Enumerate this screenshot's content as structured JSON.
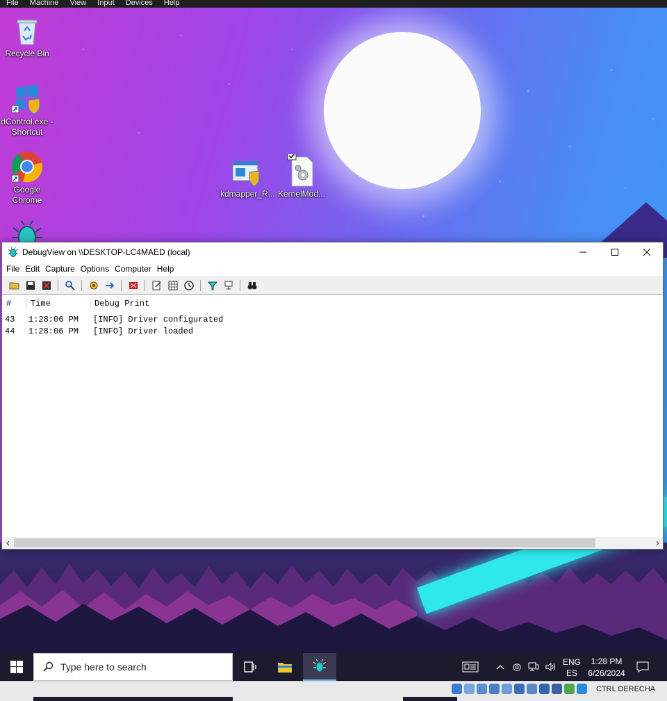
{
  "vm": {
    "menu": [
      "File",
      "Machine",
      "View",
      "Input",
      "Devices",
      "Help"
    ],
    "host_key": "CTRL DERECHA"
  },
  "desktop": {
    "icons": [
      {
        "label": "Recycle Bin"
      },
      {
        "label": "dControl.exe - Shortcut"
      },
      {
        "label": "Google Chrome"
      },
      {
        "label": "kdmapper_R..."
      },
      {
        "label": "KernelMod..."
      }
    ]
  },
  "debugview": {
    "title": "DebugView on \\\\DESKTOP-LC4MAED (local)",
    "menu": [
      "File",
      "Edit",
      "Capture",
      "Options",
      "Computer",
      "Help"
    ],
    "columns": [
      "#",
      "Time",
      "Debug Print"
    ],
    "rows": [
      {
        "num": "43",
        "time": "1:28:06 PM",
        "msg": "[INFO] Driver configurated"
      },
      {
        "num": "44",
        "time": "1:28:06 PM",
        "msg": "[INFO] Driver loaded"
      }
    ]
  },
  "taskbar": {
    "search_placeholder": "Type here to search",
    "lang_top": "ENG",
    "lang_bottom": "ES",
    "time": "1:28 PM",
    "date": "6/26/2024"
  }
}
